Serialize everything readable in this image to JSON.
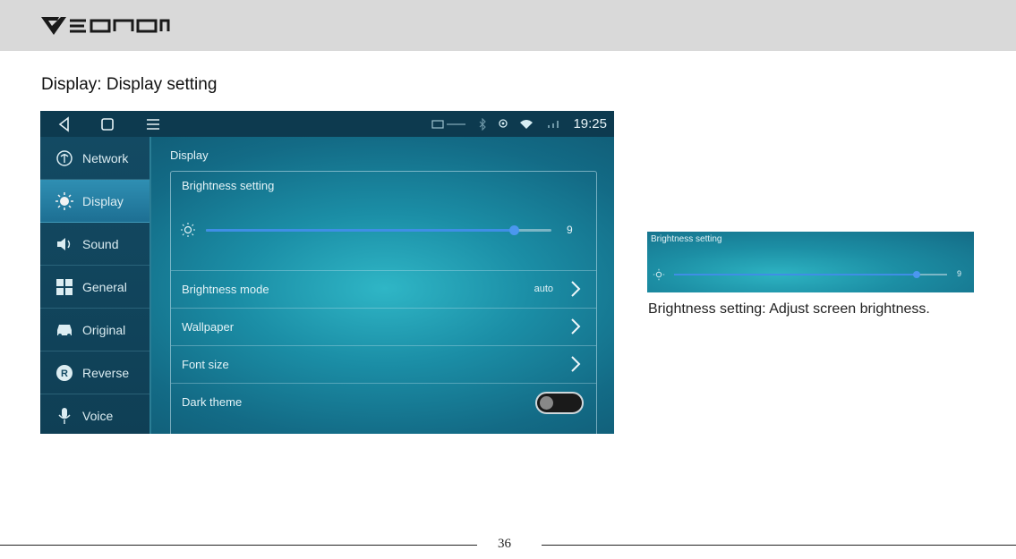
{
  "header": {
    "logo_text": "Eonon"
  },
  "section_title": "Display: Display setting",
  "device": {
    "status": {
      "clock": "19:25",
      "icons": [
        "back-icon",
        "home-icon",
        "menu-icon",
        "usb-icon",
        "bluetooth-icon",
        "gps-icon",
        "wifi-icon",
        "signal-icon"
      ]
    },
    "sidebar": [
      {
        "label": "Network",
        "icon": "network-icon",
        "active": false
      },
      {
        "label": "Display",
        "icon": "sun-icon",
        "active": true
      },
      {
        "label": "Sound",
        "icon": "speaker-icon",
        "active": false
      },
      {
        "label": "General",
        "icon": "grid-icon",
        "active": false
      },
      {
        "label": "Original",
        "icon": "car-icon",
        "active": false
      },
      {
        "label": "Reverse",
        "icon": "reverse-icon",
        "active": false
      },
      {
        "label": "Voice",
        "icon": "microphone-icon",
        "active": false
      }
    ],
    "content_title": "Display",
    "brightness": {
      "heading": "Brightness setting",
      "value": "9",
      "fraction": 0.89
    },
    "rows": [
      {
        "label": "Brightness mode",
        "value": "auto",
        "control": "chevron"
      },
      {
        "label": "Wallpaper",
        "value": "",
        "control": "chevron"
      },
      {
        "label": "Font size",
        "value": "",
        "control": "chevron"
      },
      {
        "label": "Dark theme",
        "value": "",
        "control": "toggle",
        "toggle_on": false
      }
    ]
  },
  "preview": {
    "heading": "Brightness setting",
    "value": "9",
    "fraction": 0.89
  },
  "caption": "Brightness setting: Adjust screen brightness.",
  "page_number": "36",
  "colors": {
    "accent": "#3f8ee6",
    "topbar": "#d9d9d9",
    "statusbar": "#0d3a4f"
  }
}
